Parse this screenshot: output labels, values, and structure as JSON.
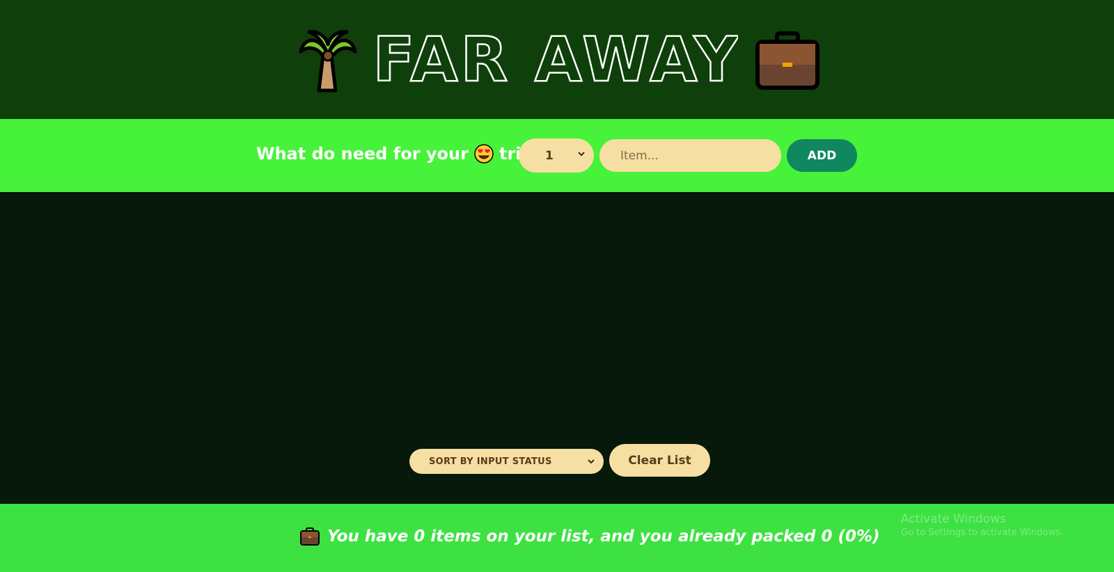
{
  "header": {
    "title": "FAR AWAY",
    "left_icon": "palm-tree-icon",
    "right_icon": "briefcase-icon"
  },
  "form": {
    "prompt_before": "What do need for your",
    "prompt_emoji": "heart-eyes-emoji-icon",
    "prompt_after": "trip",
    "quantity_value": "1",
    "item_placeholder": "Item...",
    "add_label": "ADD"
  },
  "actions": {
    "sort_value": "SORT BY INPUT STATUS",
    "clear_label": "Clear List"
  },
  "stats": {
    "icon": "briefcase-icon",
    "text": "You have 0 items on your list, and you already packed 0 (0%)"
  },
  "watermark": {
    "title": "Activate Windows",
    "subtitle": "Go to Settings to activate Windows."
  },
  "colors": {
    "header_bg": "#0f3f0a",
    "form_bg": "#47f23b",
    "list_bg": "#06190a",
    "stats_bg": "#3de142",
    "input_bg": "#f6dfa2",
    "add_button_bg": "#10875f"
  }
}
